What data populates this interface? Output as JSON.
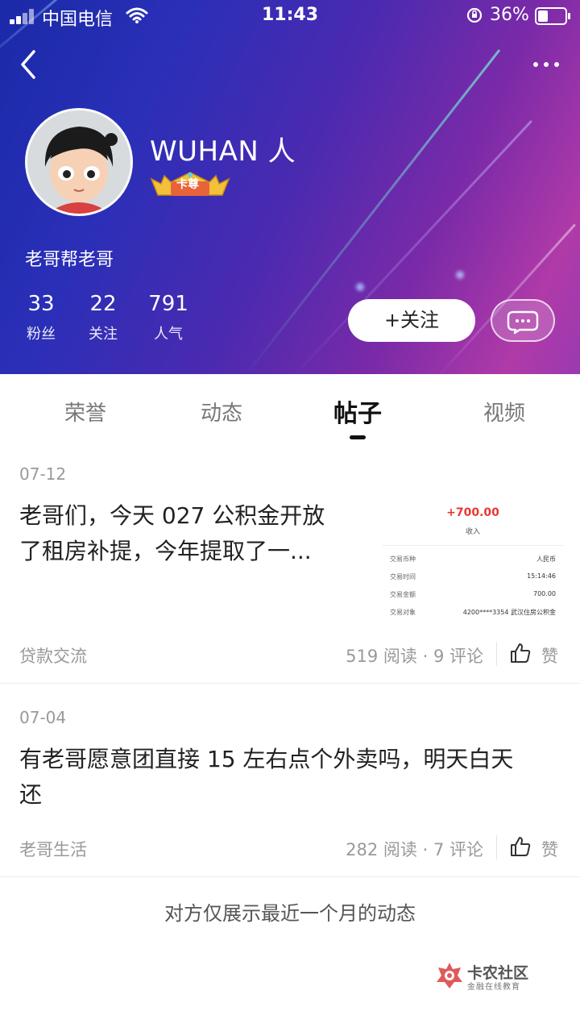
{
  "status_bar": {
    "carrier": "中国电信",
    "time": "11:43",
    "battery": "36%"
  },
  "profile": {
    "username": "WUHAN 人",
    "badge": "卡尊",
    "bio": "老哥帮老哥",
    "stats": [
      {
        "value": "33",
        "label": "粉丝"
      },
      {
        "value": "22",
        "label": "关注"
      },
      {
        "value": "791",
        "label": "人气"
      }
    ],
    "follow_label": "+关注"
  },
  "tabs": {
    "items": [
      "荣誉",
      "动态",
      "帖子",
      "视频"
    ],
    "active": "帖子"
  },
  "posts": [
    {
      "date": "07-12",
      "title_line1": "老哥们，今天 027 公积金开放",
      "title_line2": "了租房补提，今年提取了一...",
      "category": "贷款交流",
      "reads": "519 阅读",
      "comments": "9 评论",
      "like_label": "赞",
      "thumbnail": {
        "amount": "+700.00",
        "income": "收入",
        "rows": [
          {
            "label": "交易币种",
            "value": "人民币"
          },
          {
            "label": "交易时间",
            "value": "15:14:46"
          },
          {
            "label": "交易金额",
            "value": "700.00"
          },
          {
            "label": "交易对象",
            "value": "4200****3354 武汉住房公积金"
          }
        ]
      }
    },
    {
      "date": "07-04",
      "title_line1": "有老哥愿意团直接 15 左右点个外卖吗，明天白天",
      "title_line2": "还",
      "category": "老哥生活",
      "reads": "282 阅读",
      "comments": "7 评论",
      "like_label": "赞"
    }
  ],
  "footer_note": "对方仅展示最近一个月的动态",
  "watermark": {
    "name": "卡农社区",
    "tagline": "金融在线教育"
  },
  "colors": {
    "header_gradient_start": "#1a2aa8",
    "header_gradient_end": "#b03aa8",
    "amount_red": "#e53935",
    "muted_text": "#999999"
  }
}
